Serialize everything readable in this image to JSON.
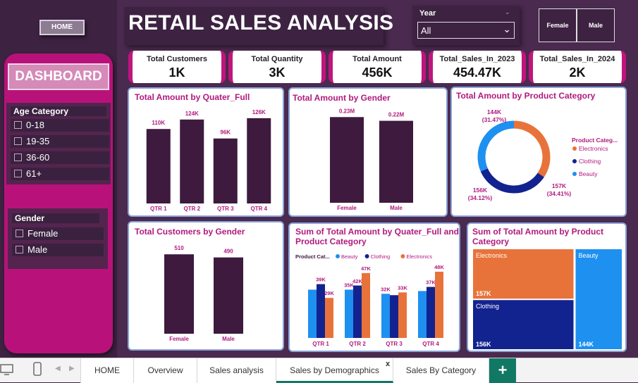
{
  "header": {
    "home_label": "HOME",
    "title": "RETAIL SALES ANALYSIS",
    "year_label": "Year",
    "year_value": "All",
    "gender_buttons": [
      "Female",
      "Male"
    ]
  },
  "sidebar": {
    "title": "DASHBOARD",
    "age_title": "Age Category",
    "age_items": [
      "0-18",
      "19-35",
      "36-60",
      "61+"
    ],
    "gender_title": "Gender",
    "gender_items": [
      "Female",
      "Male"
    ]
  },
  "kpis": [
    {
      "label": "Total Customers",
      "value": "1K"
    },
    {
      "label": "Total Quantity",
      "value": "3K"
    },
    {
      "label": "Total Amount",
      "value": "456K"
    },
    {
      "label": "Total_Sales_In_2023",
      "value": "454.47K"
    },
    {
      "label": "Total_Sales_In_2024",
      "value": "2K"
    }
  ],
  "colors": {
    "bar_dark": "#3d1a3e",
    "beauty": "#1e90f0",
    "clothing": "#12238f",
    "electronics": "#e8733a",
    "accent": "#b01a7e"
  },
  "chart_data": [
    {
      "type": "bar",
      "title": "Total Amount by Quater_Full",
      "categories": [
        "QTR 1",
        "QTR 2",
        "QTR 3",
        "QTR 4"
      ],
      "values": [
        110,
        124,
        96,
        126
      ],
      "labels": [
        "110K",
        "124K",
        "96K",
        "126K"
      ],
      "ylim": [
        0,
        130
      ]
    },
    {
      "type": "bar",
      "title": "Total Amount by Gender",
      "categories": [
        "Female",
        "Male"
      ],
      "values": [
        0.23,
        0.22
      ],
      "labels": [
        "0.23M",
        "0.22M"
      ],
      "ylim": [
        0,
        0.24
      ]
    },
    {
      "type": "pie",
      "title": "Total Amount by Product Category",
      "legend_title": "Product Categ...",
      "categories": [
        "Electronics",
        "Clothing",
        "Beauty"
      ],
      "values": [
        157,
        156,
        144
      ],
      "labels": [
        "157K\n(34.41%)",
        "156K\n(34.12%)",
        "144K\n(31.47%)"
      ],
      "legend": "right"
    },
    {
      "type": "bar",
      "title": "Total Customers by Gender",
      "categories": [
        "Female",
        "Male"
      ],
      "values": [
        510,
        490
      ],
      "labels": [
        "510",
        "490"
      ],
      "ylim": [
        0,
        520
      ]
    },
    {
      "type": "bar",
      "title": "Sum of Total Amount by Quater_Full and Product Category",
      "legend_title": "Product Cat...",
      "categories": [
        "QTR 1",
        "QTR 2",
        "QTR 3",
        "QTR 4"
      ],
      "series": [
        {
          "name": "Beauty",
          "values": [
            35,
            35,
            32,
            34
          ],
          "labels": [
            "",
            "35K",
            "32K",
            ""
          ]
        },
        {
          "name": "Clothing",
          "values": [
            39,
            38,
            31,
            37
          ],
          "labels": [
            "39K",
            "",
            "",
            "37K"
          ]
        },
        {
          "name": "Electronics",
          "values": [
            29,
            47,
            33,
            48
          ],
          "labels": [
            "29K",
            "47K",
            "33K",
            "48K"
          ]
        }
      ],
      "extra_labels": [
        "42K"
      ],
      "ylim": [
        0,
        50
      ]
    },
    {
      "type": "heatmap",
      "title": "Sum of Total Amount by Product Category",
      "categories": [
        "Electronics",
        "Clothing",
        "Beauty"
      ],
      "values": [
        157,
        156,
        144
      ],
      "labels": [
        "157K",
        "156K",
        "144K"
      ]
    }
  ],
  "tabs": {
    "items": [
      "HOME",
      "Overview",
      "Sales analysis",
      "Sales by Demographics",
      "Sales By Category"
    ],
    "active": "Sales by Demographics",
    "close": "x",
    "add": "+"
  }
}
